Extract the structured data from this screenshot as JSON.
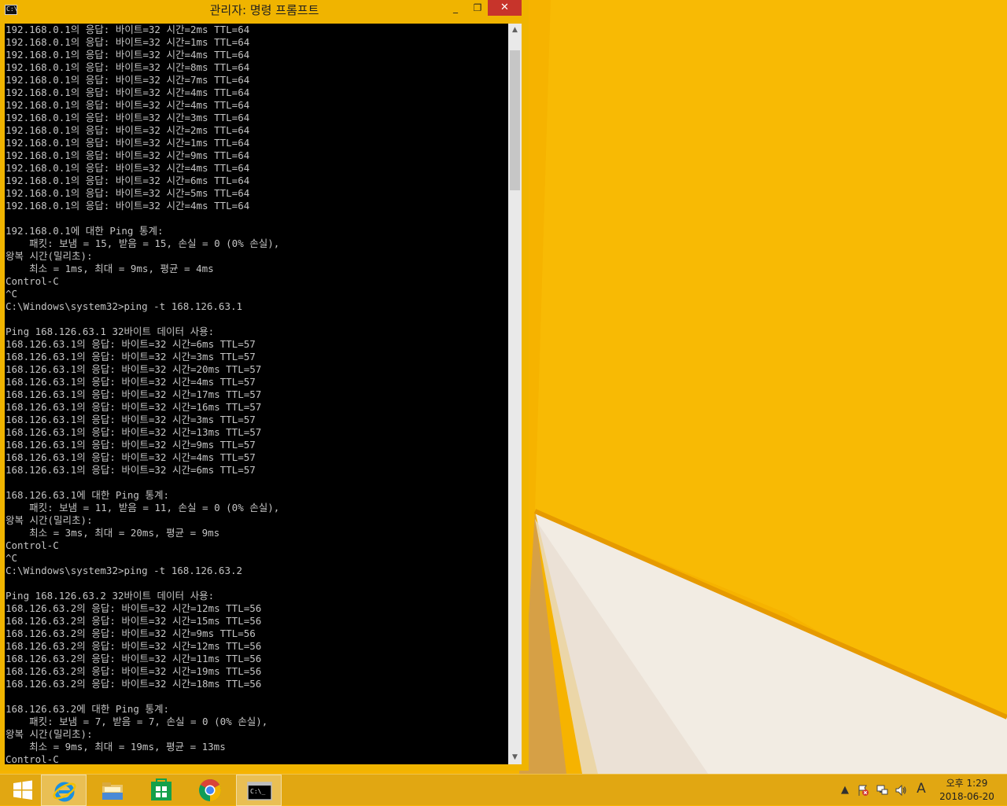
{
  "window": {
    "title": "관리자: 명령 프롬프트",
    "icon_text": "C:\\",
    "buttons": {
      "minimize": "_",
      "maximize": "❐",
      "close": "✕"
    }
  },
  "console": {
    "lines": [
      "192.168.0.1의 응답: 바이트=32 시간=2ms TTL=64",
      "192.168.0.1의 응답: 바이트=32 시간=1ms TTL=64",
      "192.168.0.1의 응답: 바이트=32 시간=4ms TTL=64",
      "192.168.0.1의 응답: 바이트=32 시간=8ms TTL=64",
      "192.168.0.1의 응답: 바이트=32 시간=7ms TTL=64",
      "192.168.0.1의 응답: 바이트=32 시간=4ms TTL=64",
      "192.168.0.1의 응답: 바이트=32 시간=4ms TTL=64",
      "192.168.0.1의 응답: 바이트=32 시간=3ms TTL=64",
      "192.168.0.1의 응답: 바이트=32 시간=2ms TTL=64",
      "192.168.0.1의 응답: 바이트=32 시간=1ms TTL=64",
      "192.168.0.1의 응답: 바이트=32 시간=9ms TTL=64",
      "192.168.0.1의 응답: 바이트=32 시간=4ms TTL=64",
      "192.168.0.1의 응답: 바이트=32 시간=6ms TTL=64",
      "192.168.0.1의 응답: 바이트=32 시간=5ms TTL=64",
      "192.168.0.1의 응답: 바이트=32 시간=4ms TTL=64",
      "",
      "192.168.0.1에 대한 Ping 통계:",
      "    패킷: 보냄 = 15, 받음 = 15, 손실 = 0 (0% 손실),",
      "왕복 시간(밀리초):",
      "    최소 = 1ms, 최대 = 9ms, 평균 = 4ms",
      "Control-C",
      "^C",
      "C:\\Windows\\system32>ping -t 168.126.63.1",
      "",
      "Ping 168.126.63.1 32바이트 데이터 사용:",
      "168.126.63.1의 응답: 바이트=32 시간=6ms TTL=57",
      "168.126.63.1의 응답: 바이트=32 시간=3ms TTL=57",
      "168.126.63.1의 응답: 바이트=32 시간=20ms TTL=57",
      "168.126.63.1의 응답: 바이트=32 시간=4ms TTL=57",
      "168.126.63.1의 응답: 바이트=32 시간=17ms TTL=57",
      "168.126.63.1의 응답: 바이트=32 시간=16ms TTL=57",
      "168.126.63.1의 응답: 바이트=32 시간=3ms TTL=57",
      "168.126.63.1의 응답: 바이트=32 시간=13ms TTL=57",
      "168.126.63.1의 응답: 바이트=32 시간=9ms TTL=57",
      "168.126.63.1의 응답: 바이트=32 시간=4ms TTL=57",
      "168.126.63.1의 응답: 바이트=32 시간=6ms TTL=57",
      "",
      "168.126.63.1에 대한 Ping 통계:",
      "    패킷: 보냄 = 11, 받음 = 11, 손실 = 0 (0% 손실),",
      "왕복 시간(밀리초):",
      "    최소 = 3ms, 최대 = 20ms, 평균 = 9ms",
      "Control-C",
      "^C",
      "C:\\Windows\\system32>ping -t 168.126.63.2",
      "",
      "Ping 168.126.63.2 32바이트 데이터 사용:",
      "168.126.63.2의 응답: 바이트=32 시간=12ms TTL=56",
      "168.126.63.2의 응답: 바이트=32 시간=15ms TTL=56",
      "168.126.63.2의 응답: 바이트=32 시간=9ms TTL=56",
      "168.126.63.2의 응답: 바이트=32 시간=12ms TTL=56",
      "168.126.63.2의 응답: 바이트=32 시간=11ms TTL=56",
      "168.126.63.2의 응답: 바이트=32 시간=19ms TTL=56",
      "168.126.63.2의 응답: 바이트=32 시간=18ms TTL=56",
      "",
      "168.126.63.2에 대한 Ping 통계:",
      "    패킷: 보냄 = 7, 받음 = 7, 손실 = 0 (0% 손실),",
      "왕복 시간(밀리초):",
      "    최소 = 9ms, 최대 = 19ms, 평균 = 13ms",
      "Control-C"
    ],
    "text_color": "#c4c4c4",
    "background": "#000000"
  },
  "scrollbar": {
    "up_arrow": "▲",
    "down_arrow": "▼"
  },
  "taskbar": {
    "items": [
      {
        "icon": "windows-start-icon",
        "active": false
      },
      {
        "icon": "internet-explorer-icon",
        "active": false
      },
      {
        "icon": "file-explorer-icon",
        "active": false
      },
      {
        "icon": "windows-store-icon",
        "active": false
      },
      {
        "icon": "chrome-icon",
        "active": false
      },
      {
        "icon": "command-prompt-icon",
        "active": true
      }
    ],
    "tray": {
      "chevron": "▲",
      "icons": [
        "flag-icon",
        "network-icon",
        "volume-icon"
      ],
      "ime": "A",
      "time": "오후 1:29",
      "date": "2018-06-20"
    }
  },
  "colors": {
    "accent": "#f0b400",
    "close": "#c7342b",
    "desktop": "#f7b400"
  }
}
